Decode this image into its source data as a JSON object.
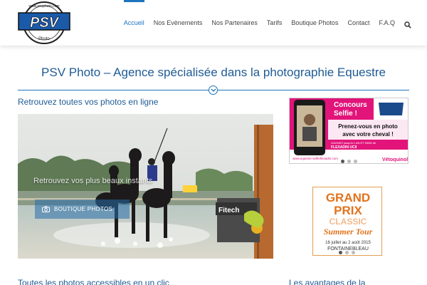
{
  "header": {
    "logo": {
      "main": "PSV",
      "sub": "Photo",
      "url_ring": "www.psvphoto.com"
    },
    "nav": [
      {
        "label": "Accueil",
        "active": true
      },
      {
        "label": "Nos Evènements",
        "active": false
      },
      {
        "label": "Nos Partenaires",
        "active": false
      },
      {
        "label": "Tarifs",
        "active": false
      },
      {
        "label": "Boutique Photos",
        "active": false
      },
      {
        "label": "Contact",
        "active": false
      },
      {
        "label": "F.A.Q",
        "active": false
      }
    ],
    "search_icon": "search-icon"
  },
  "main": {
    "title": "PSV Photo – Agence spécialisée dans la photographie Equestre",
    "section_heading": "Retrouvez toutes vos photos en ligne",
    "hero": {
      "caption": "Retrouvez vos plus beaux instants",
      "button_label": "BOUTIQUE PHOTOS",
      "sign_text": "Fitech"
    },
    "bottom_heading_left": "Toutes les photos accessibles en un clic",
    "bottom_heading_right": "Les avantages de la"
  },
  "sidebar": {
    "ad1": {
      "line1": "Concours",
      "line2": "Selfie !",
      "line3": "Prenez-vous en photo",
      "line4": "avec votre cheval !",
      "line5": "GAGNEZ jusqu'à 1 AN ET DEMI de",
      "line6": "FLEXADIN UCII",
      "url": "www.equistre-selfieflexadin.com",
      "brand": "Vétoquinol"
    },
    "ad2": {
      "line1": "GRAND",
      "line2": "PRIX",
      "line3": "CLASSIC",
      "line4": "Summer Tour",
      "dates": "16 juillet au 2 août 2015",
      "place": "FONTAINEBLEAU"
    }
  },
  "colors": {
    "accent": "#1e73be",
    "heading": "#1e5b94"
  }
}
